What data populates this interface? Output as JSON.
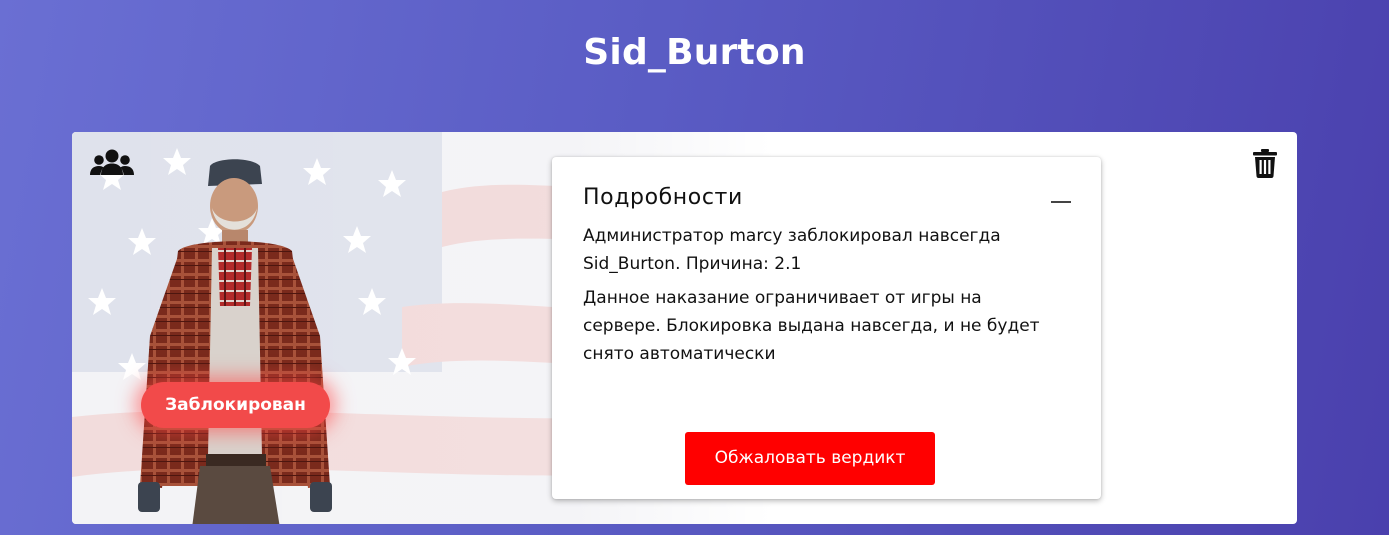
{
  "page": {
    "title": "Sid_Burton"
  },
  "status": {
    "label": "Заблокирован",
    "color": "#f24a4a"
  },
  "details": {
    "title": "Подробности",
    "collapse_icon": "minus-icon",
    "summary": "Администратор marcy заблокировал навсегда Sid_Burton. Причина: 2.1",
    "description": "Данное наказание ограничивает от игры на сервере. Блокировка выдана навсегда, и не будет снято автоматически",
    "appeal_button_label": "Обжаловать вердикт",
    "appeal_button_color": "#ff0000"
  },
  "icons": {
    "players": "users-icon",
    "delete": "trash-icon"
  },
  "colors": {
    "background_start": "#6a6fd3",
    "background_end": "#4a40ad"
  }
}
